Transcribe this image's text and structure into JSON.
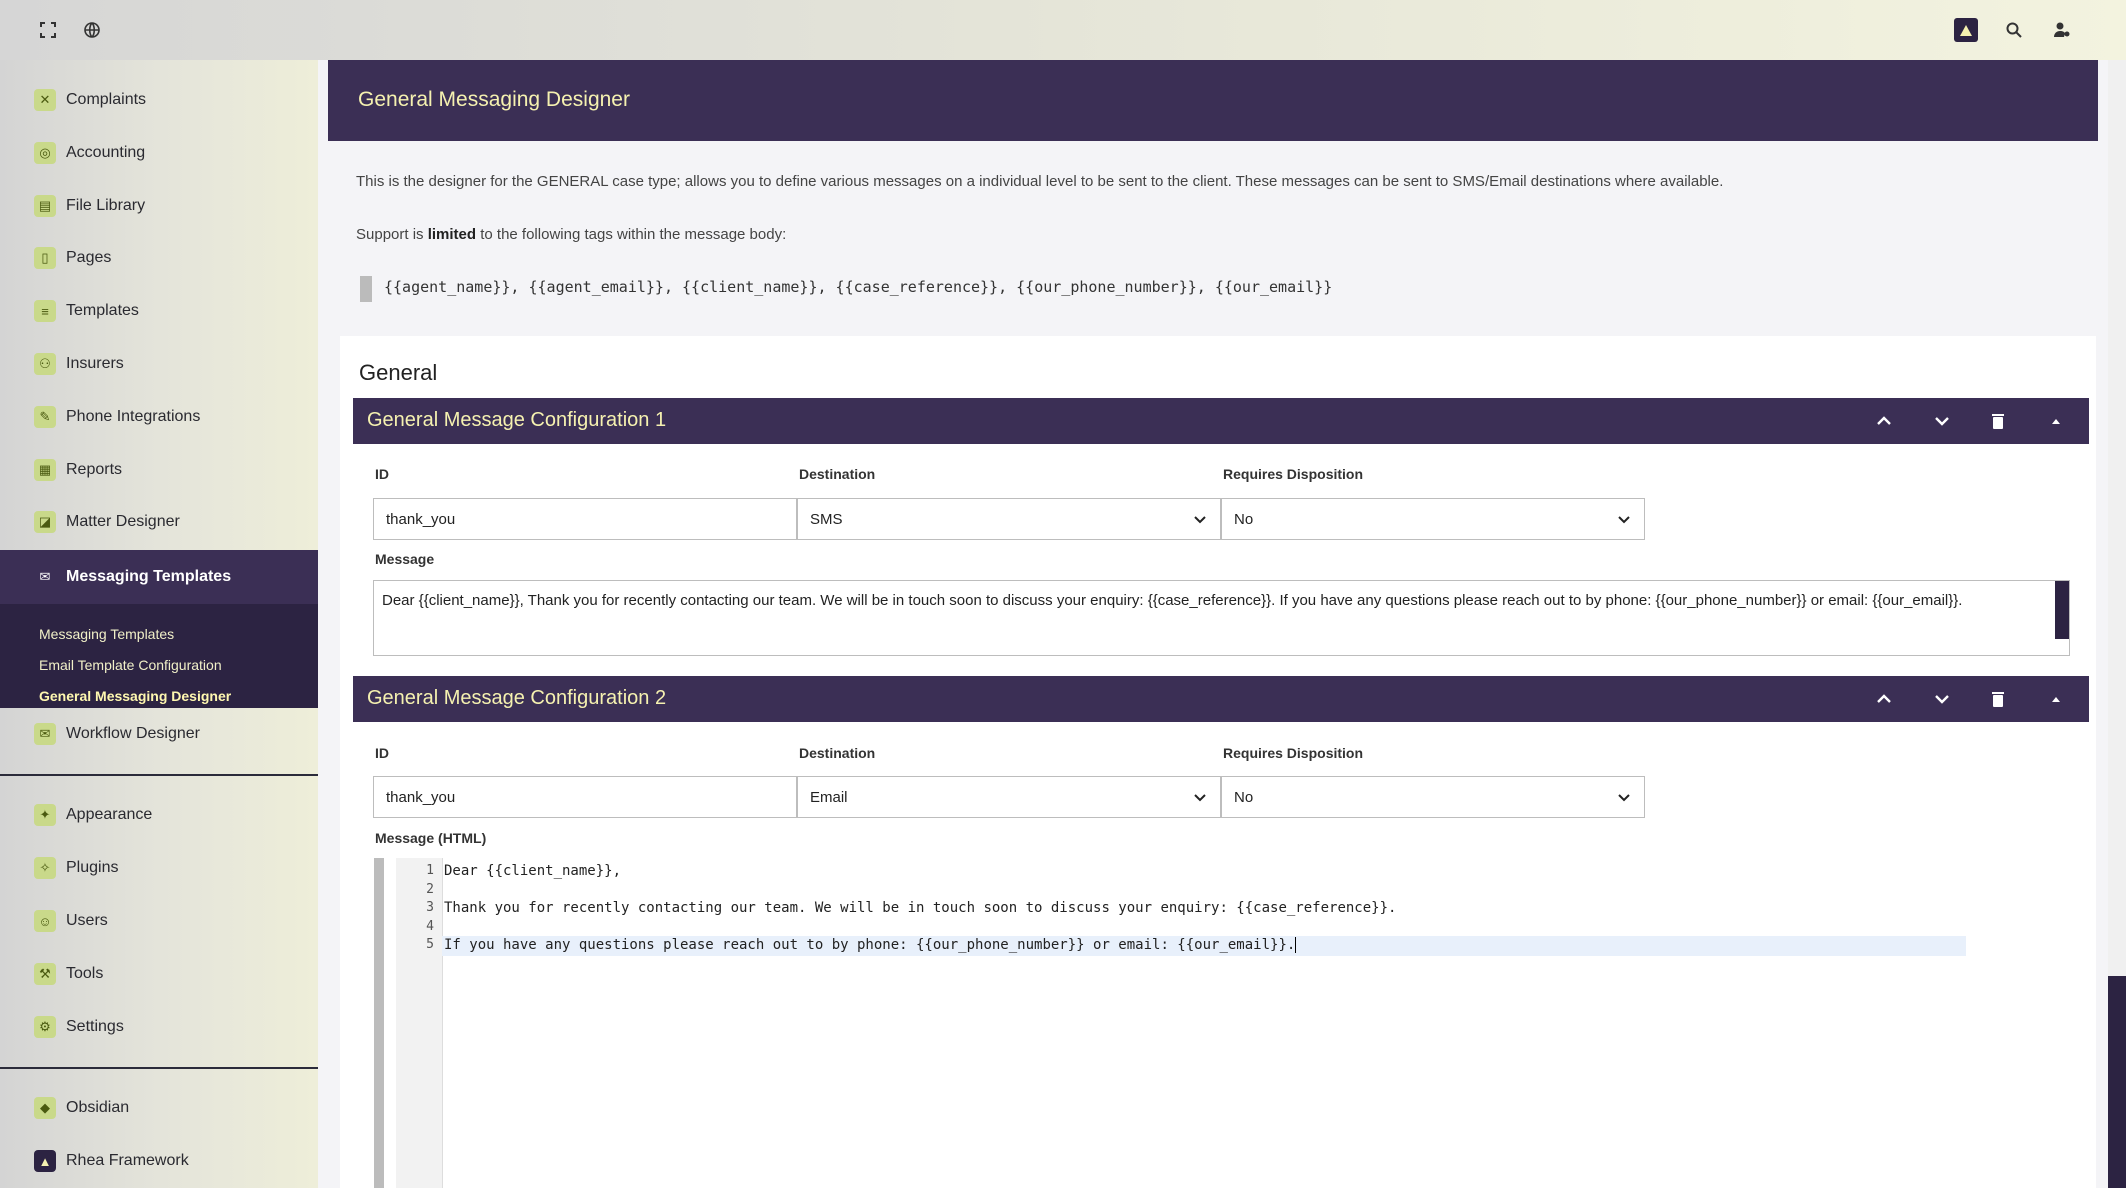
{
  "sidebar": {
    "items": [
      {
        "label": "Complaints",
        "icon": "complaint-icon"
      },
      {
        "label": "Accounting",
        "icon": "accounting-icon"
      },
      {
        "label": "File Library",
        "icon": "file-library-icon"
      },
      {
        "label": "Pages",
        "icon": "pages-icon"
      },
      {
        "label": "Templates",
        "icon": "templates-icon"
      },
      {
        "label": "Insurers",
        "icon": "insurers-icon"
      },
      {
        "label": "Phone Integrations",
        "icon": "phone-icon"
      },
      {
        "label": "Reports",
        "icon": "reports-icon"
      },
      {
        "label": "Matter Designer",
        "icon": "matter-icon"
      },
      {
        "label": "Messaging Templates",
        "icon": "mail-icon"
      },
      {
        "label": "Workflow Designer",
        "icon": "mail-icon"
      },
      {
        "label": "Appearance",
        "icon": "appearance-icon"
      },
      {
        "label": "Plugins",
        "icon": "plugins-icon"
      },
      {
        "label": "Users",
        "icon": "users-icon"
      },
      {
        "label": "Tools",
        "icon": "tools-icon"
      },
      {
        "label": "Settings",
        "icon": "settings-icon"
      },
      {
        "label": "Obsidian",
        "icon": "obsidian-icon"
      },
      {
        "label": "Rhea Framework",
        "icon": "rhea-icon"
      }
    ],
    "submenu": [
      "Messaging Templates",
      "Email Template Configuration",
      "General Messaging Designer"
    ]
  },
  "header": {
    "title": "General Messaging Designer"
  },
  "intro": "This is the designer for the GENERAL case type; allows you to define various messages on a individual level to be sent to the client. These messages can be sent to SMS/Email destinations where available.",
  "support": {
    "prefix": "Support is ",
    "bold": "limited",
    "suffix": " to the following tags within the message body:"
  },
  "tags": "{{agent_name}}, {{agent_email}}, {{client_name}}, {{case_reference}}, {{our_phone_number}}, {{our_email}}",
  "section_title": "General",
  "labels": {
    "id": "ID",
    "destination": "Destination",
    "requires": "Requires Disposition",
    "message": "Message",
    "message_html": "Message (HTML)"
  },
  "config1": {
    "title": "General Message Configuration 1",
    "id": "thank_you",
    "destination": "SMS",
    "requires": "No",
    "message": "Dear {{client_name}}, Thank you for recently contacting our team. We will be in touch soon to discuss your enquiry: {{case_reference}}. If you have any questions please reach out to by phone: {{our_phone_number}} or email: {{our_email}}."
  },
  "config2": {
    "title": "General Message Configuration 2",
    "id": "thank_you",
    "destination": "Email",
    "requires": "No",
    "code_lines": [
      "Dear {{client_name}},",
      "",
      "Thank you for recently contacting our team. We will be in touch soon to discuss your enquiry: {{case_reference}}.",
      "",
      "If you have any questions please reach out to by phone: {{our_phone_number}} or email: {{our_email}}."
    ],
    "line_numbers": [
      "1",
      "2",
      "3",
      "4",
      "5"
    ]
  },
  "colors": {
    "primary": "#3b2f55",
    "accent_text": "#f5f1b0"
  }
}
